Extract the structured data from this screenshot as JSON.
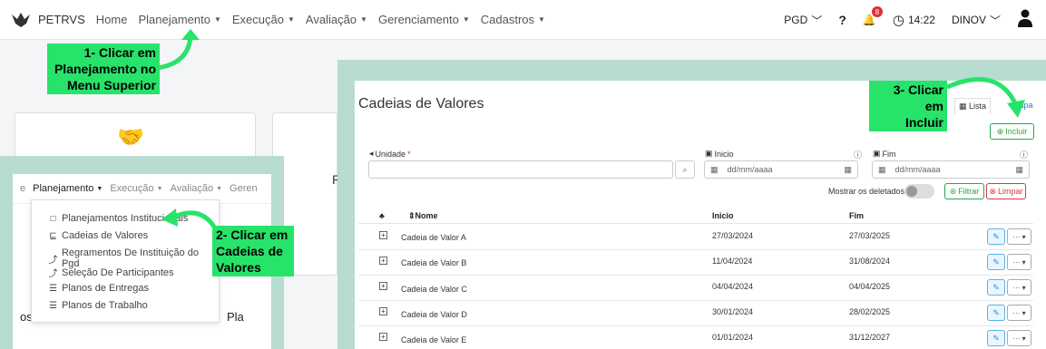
{
  "navbar": {
    "brand": "PETRVS",
    "items": [
      {
        "label": "Home",
        "caret": false
      },
      {
        "label": "Planejamento",
        "caret": true
      },
      {
        "label": "Execução",
        "caret": true
      },
      {
        "label": "Avaliação",
        "caret": true
      },
      {
        "label": "Gerenciamento",
        "caret": true
      },
      {
        "label": "Cadastros",
        "caret": true
      }
    ],
    "pgd": "PGD",
    "help": "?",
    "notif_count": "8",
    "time": "14:22",
    "user": "DINOV"
  },
  "callouts": {
    "c1": [
      "1- Clicar em",
      "Planejamento no",
      "Menu Superior"
    ],
    "c2": [
      "2- Clicar em",
      "Cadeias de",
      "Valores"
    ],
    "c3": [
      "3- Clicar em",
      "Incluir"
    ]
  },
  "mini_nav": {
    "items": [
      "e",
      "Planejamento",
      "Execução",
      "Avaliação",
      "Geren"
    ]
  },
  "dropdown": {
    "items": [
      {
        "icon": "□",
        "label": "Planejamentos Institucionais"
      },
      {
        "icon": "⊑",
        "label": "Cadeias de Valores"
      },
      {
        "icon": "⤴",
        "label": "Regramentos De Instituição do Pgd"
      },
      {
        "icon": "⤴",
        "label": "Seleção De Participantes"
      },
      {
        "icon": "☰",
        "label": "Planos de Entregas"
      },
      {
        "icon": "☰",
        "label": "Planos de Trabalho"
      }
    ],
    "side_text": "os",
    "side_text2": "Pla"
  },
  "bg_text": {
    "r": "R"
  },
  "panel": {
    "title": "Cadeias de Valores",
    "tab_lista": "Lista",
    "tab_mapa": "Mapa",
    "incluir": "Incluir",
    "unidade_label": "Unidade",
    "inicio_label": "Inicio",
    "fim_label": "Fim",
    "date_placeholder": "dd/mm/aaaa",
    "mostrar_deletados": "Mostrar os deletados",
    "filtrar": "Filtrar",
    "limpar": "Limpar",
    "columns": [
      "Nome",
      "Inicio",
      "Fim"
    ],
    "rows": [
      {
        "nome": "Cadeia de Valor A",
        "inicio": "27/03/2024",
        "fim": "27/03/2025"
      },
      {
        "nome": "Cadeia de Valor B",
        "inicio": "11/04/2024",
        "fim": "31/08/2024"
      },
      {
        "nome": "Cadeia de Valor C",
        "inicio": "04/04/2024",
        "fim": "04/04/2025"
      },
      {
        "nome": "Cadeia de Valor D",
        "inicio": "30/01/2024",
        "fim": "28/02/2025"
      },
      {
        "nome": "Cadeia de Valor E",
        "inicio": "01/01/2024",
        "fim": "31/12/2027"
      }
    ]
  },
  "colors": {
    "callout": "#27e36a",
    "inset": "#b7dcd2",
    "primary": "#2a73cc",
    "success": "#28a745",
    "danger": "#dc3545"
  }
}
